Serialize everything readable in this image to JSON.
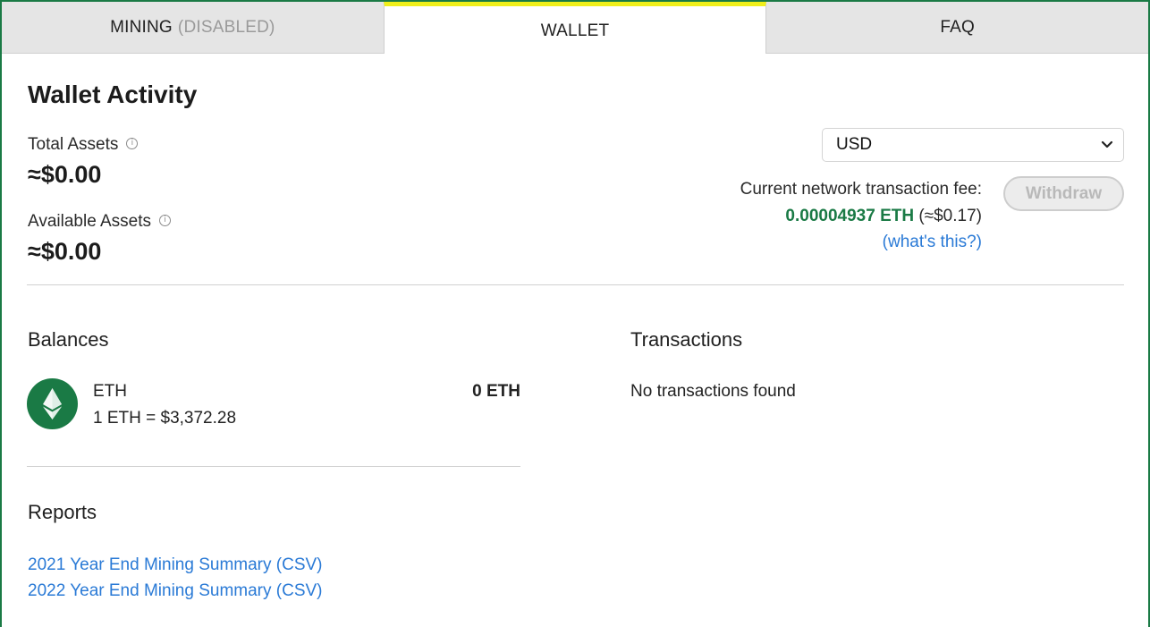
{
  "tabs": {
    "mining_label": "MINING",
    "mining_status": "(DISABLED)",
    "wallet_label": "WALLET",
    "faq_label": "FAQ"
  },
  "wallet": {
    "title": "Wallet Activity",
    "total_assets_label": "Total Assets",
    "total_assets_value": "≈$0.00",
    "available_assets_label": "Available Assets",
    "available_assets_value": "≈$0.00",
    "info_glyph": "i"
  },
  "currency_select": {
    "selected": "USD",
    "chevron": "❯"
  },
  "fee": {
    "label": "Current network transaction fee:",
    "eth": "0.00004937 ETH",
    "usd": "(≈$0.17)",
    "help_link": "(what's this?)"
  },
  "withdraw_button": "Withdraw",
  "balances": {
    "title": "Balances",
    "items": [
      {
        "name": "ETH",
        "rate": "1 ETH = $3,372.28",
        "balance": "0 ETH",
        "icon": "ethereum-icon"
      }
    ]
  },
  "transactions": {
    "title": "Transactions",
    "empty_text": "No transactions found"
  },
  "reports": {
    "title": "Reports",
    "links": [
      "2021 Year End Mining Summary (CSV)",
      "2022 Year End Mining Summary (CSV)"
    ]
  },
  "colors": {
    "brand_green": "#1a7a45",
    "active_tab_accent": "#f0ef1a",
    "link_blue": "#2a7ad6"
  }
}
